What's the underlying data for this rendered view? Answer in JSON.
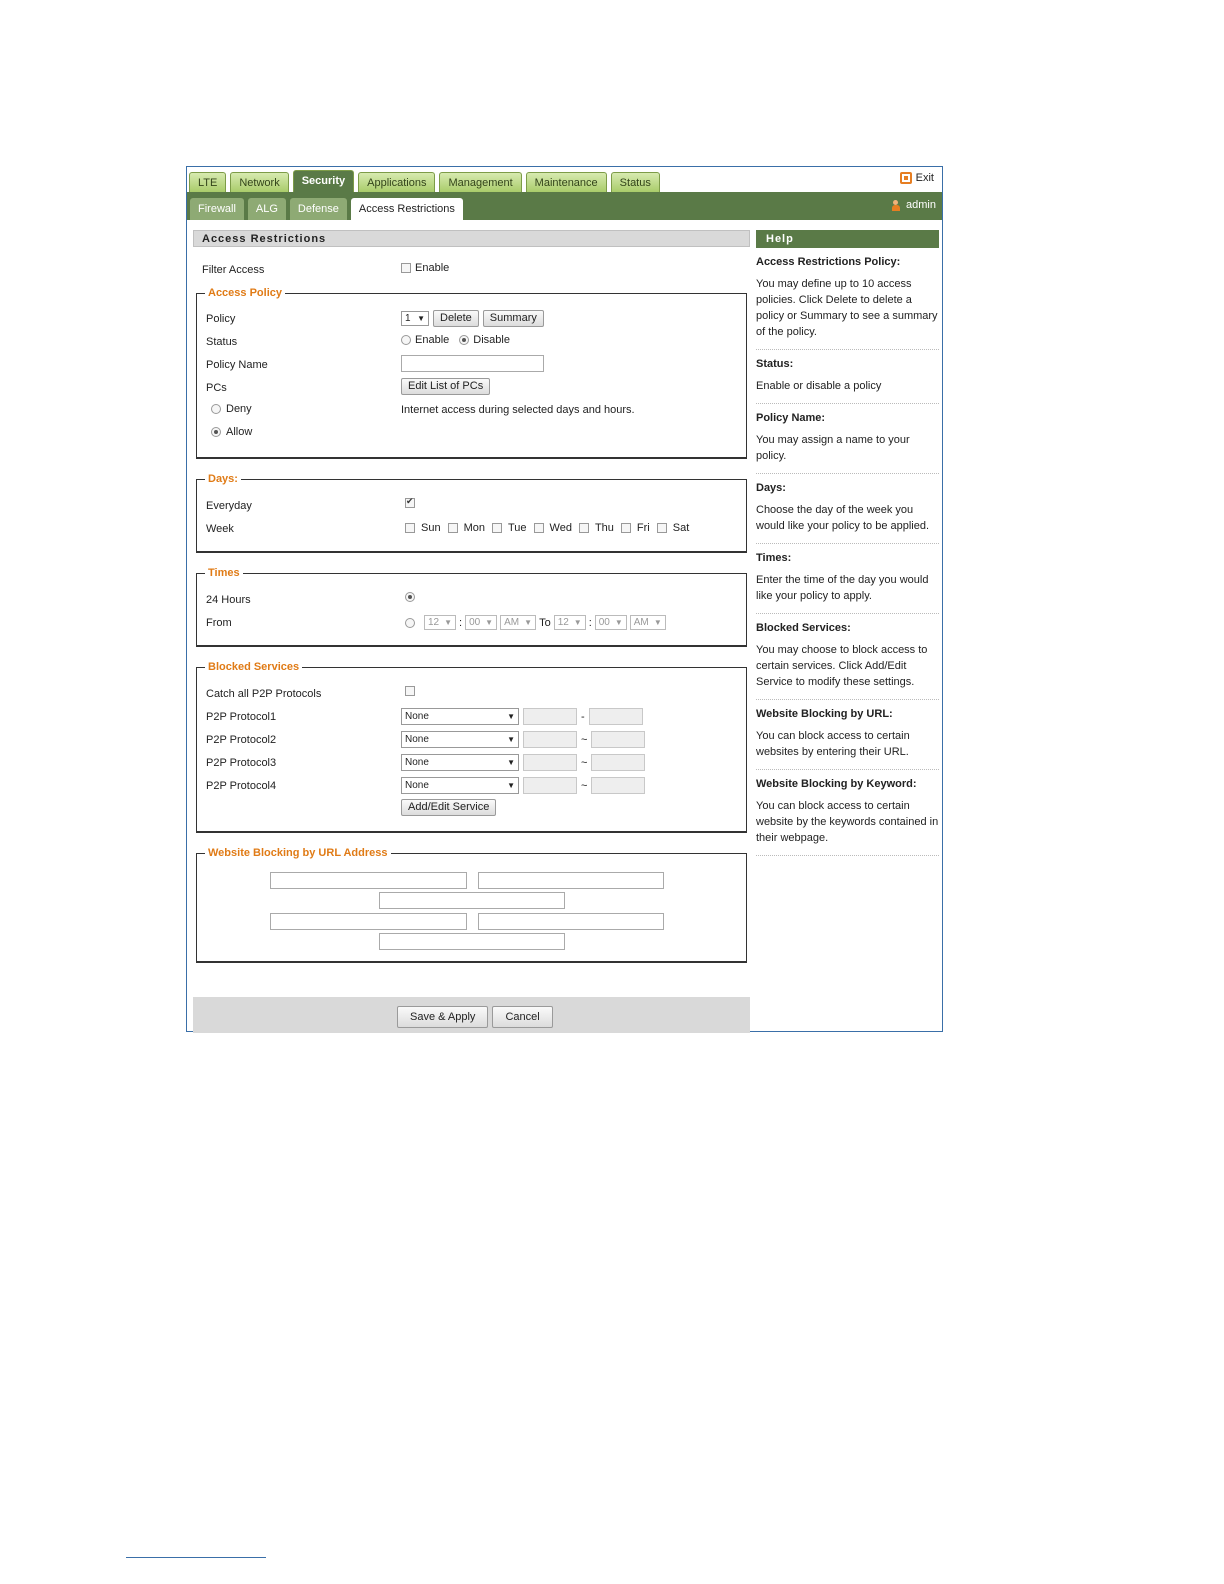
{
  "top_tabs": [
    "LTE",
    "Network",
    "Security",
    "Applications",
    "Management",
    "Maintenance",
    "Status"
  ],
  "active_top_tab": "Security",
  "exit_label": "Exit",
  "sub_tabs": [
    "Firewall",
    "ALG",
    "Defense",
    "Access Restrictions"
  ],
  "active_sub_tab": "Access Restrictions",
  "user_label": "admin",
  "section_title": "Access Restrictions",
  "filter_access": {
    "label": "Filter Access",
    "enable_label": "Enable"
  },
  "access_policy": {
    "legend": "Access Policy",
    "policy_label": "Policy",
    "policy_value": "1",
    "delete_button": "Delete",
    "summary_button": "Summary",
    "status_label": "Status",
    "status_enable": "Enable",
    "status_disable": "Disable",
    "policy_name_label": "Policy Name",
    "policy_name_value": "",
    "pcs_label": "PCs",
    "edit_pcs_button": "Edit List of PCs",
    "deny_label": "Deny",
    "allow_label": "Allow",
    "access_text": "Internet access during selected days and hours."
  },
  "days": {
    "legend": "Days:",
    "everyday_label": "Everyday",
    "week_label": "Week",
    "weekdays": [
      "Sun",
      "Mon",
      "Tue",
      "Wed",
      "Thu",
      "Fri",
      "Sat"
    ]
  },
  "times": {
    "legend": "Times",
    "hours24_label": "24 Hours",
    "from_label": "From",
    "from_hour": "12",
    "from_min": "00",
    "from_ampm": "AM",
    "to_label": "To",
    "to_hour": "12",
    "to_min": "00",
    "to_ampm": "AM"
  },
  "blocked_services": {
    "legend": "Blocked Services",
    "catch_all_label": "Catch all P2P Protocols",
    "protocols": [
      {
        "label": "P2P Protocol1",
        "value": "None",
        "sep": "-"
      },
      {
        "label": "P2P Protocol2",
        "value": "None",
        "sep": "~"
      },
      {
        "label": "P2P Protocol3",
        "value": "None",
        "sep": "~"
      },
      {
        "label": "P2P Protocol4",
        "value": "None",
        "sep": "~"
      }
    ],
    "add_edit_button": "Add/Edit Service"
  },
  "url_blocking": {
    "legend": "Website Blocking by URL Address"
  },
  "footer": {
    "save_button": "Save & Apply",
    "cancel_button": "Cancel"
  },
  "help": {
    "title": "Help",
    "items": [
      {
        "title": "Access Restrictions Policy:",
        "body": "You may define up to 10 access policies. Click Delete to delete a policy or Summary to see a summary of the policy."
      },
      {
        "title": "Status:",
        "body": "Enable or disable a policy"
      },
      {
        "title": "Policy Name:",
        "body": "You may assign a name to your policy."
      },
      {
        "title": "Days:",
        "body": "Choose the day of the week you would like your policy to be applied."
      },
      {
        "title": "Times:",
        "body": "Enter the time of the day you would like your policy to apply."
      },
      {
        "title": "Blocked Services:",
        "body": "You may choose to block access to certain services. Click Add/Edit Service to modify these settings."
      },
      {
        "title": "Website Blocking by URL:",
        "body": "You can block access to certain websites by entering their URL."
      },
      {
        "title": "Website Blocking by Keyword:",
        "body": "You can block access to certain website by the keywords contained in their webpage."
      }
    ]
  }
}
